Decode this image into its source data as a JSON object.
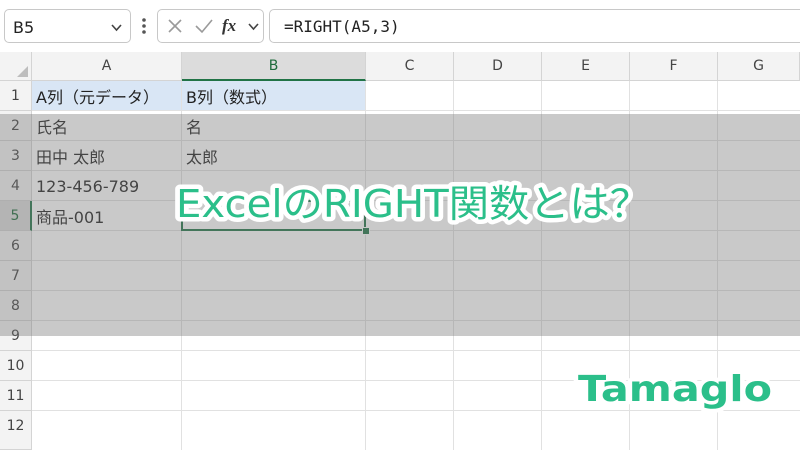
{
  "formula_bar": {
    "name_box": "B5",
    "cancel_icon": "cancel-x-icon",
    "enter_icon": "checkmark-icon",
    "function_icon": "fx-icon",
    "formula": "=RIGHT(A5,3)"
  },
  "columns": [
    "A",
    "B",
    "C",
    "D",
    "E",
    "F",
    "G"
  ],
  "rows": [
    "1",
    "2",
    "3",
    "4",
    "5",
    "6",
    "7",
    "8",
    "9",
    "10",
    "11",
    "12"
  ],
  "cells": {
    "A1": "A列（元データ）",
    "B1": "B列（数式）",
    "A2": "氏名",
    "B2": "名",
    "A3": "田中 太郎",
    "B3": "太郎",
    "A4": "123-456-789",
    "A5": "商品-001"
  },
  "overlay": {
    "title": "ExcelのRIGHT関数とは？",
    "brand": "Tamaglo"
  },
  "colors": {
    "accent_green": "#2bbf8a",
    "excel_green": "#217346",
    "header_highlight": "#d9e6f5"
  }
}
